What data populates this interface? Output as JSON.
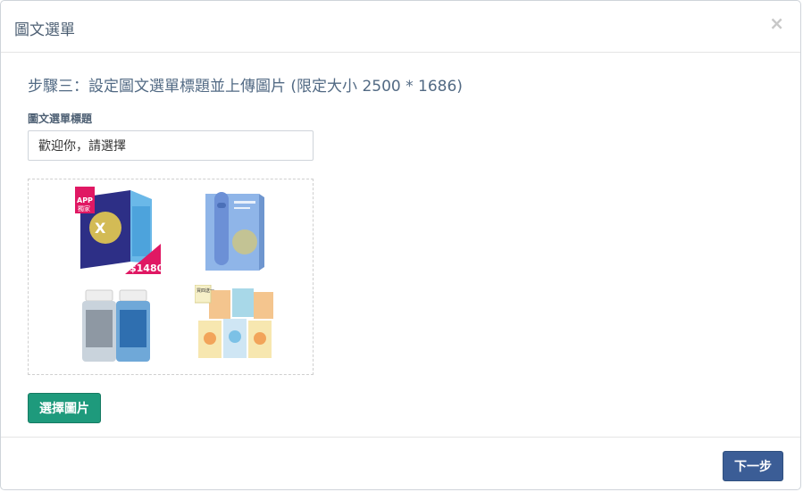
{
  "modal": {
    "title": "圖文選單",
    "close_symbol": "×"
  },
  "step": {
    "title": "步驟三：設定圖文選單標題並上傳圖片 (限定大小 2500 * 1686)"
  },
  "menu_title_field": {
    "label": "圖文選單標題",
    "value": "歡迎你，請選擇"
  },
  "image_preview": {
    "products": [
      {
        "icon": "supplement-box-icon",
        "badge_text": "APP",
        "badge_sub": "獨家",
        "price_tag": "$1480"
      },
      {
        "icon": "beauty-device-box-icon"
      },
      {
        "icon": "toner-bottles-icon"
      },
      {
        "icon": "mask-packs-icon",
        "badge_text": "買四送一"
      }
    ]
  },
  "buttons": {
    "choose_image": "選擇圖片",
    "next_step": "下一步"
  },
  "colors": {
    "primary_green": "#1e9a7c",
    "primary_blue": "#3b5d96",
    "heading_text": "#526a84"
  }
}
